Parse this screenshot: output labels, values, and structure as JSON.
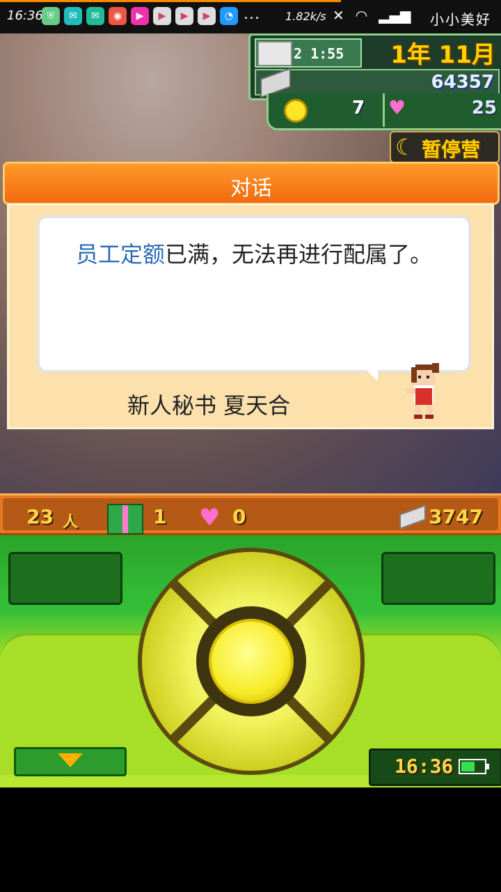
{
  "status_bar": {
    "time": "16:36",
    "more": "...",
    "net_speed": "1.82k/s",
    "carrier": "小小美好"
  },
  "hud": {
    "game_time": "2 1:55",
    "date": "1年 11月",
    "money": "64357",
    "coins": "7",
    "hearts": "25",
    "pause_label": "暂停营业"
  },
  "dialog": {
    "title": "对话",
    "message_highlight": "员工定额",
    "message_rest": "已满，无法再进行配属了。",
    "speaker": "新人秘书 夏天合"
  },
  "info_bar": {
    "staff_count": "23",
    "staff_unit": "人",
    "gifts": "1",
    "likes": "0",
    "cash": "3747"
  },
  "panel": {
    "clock": "16:36",
    "battery_level": 0.6
  },
  "colors": {
    "accent_orange": "#f26a10",
    "panel_green": "#34c038",
    "highlight_blue": "#2c6bb8"
  }
}
